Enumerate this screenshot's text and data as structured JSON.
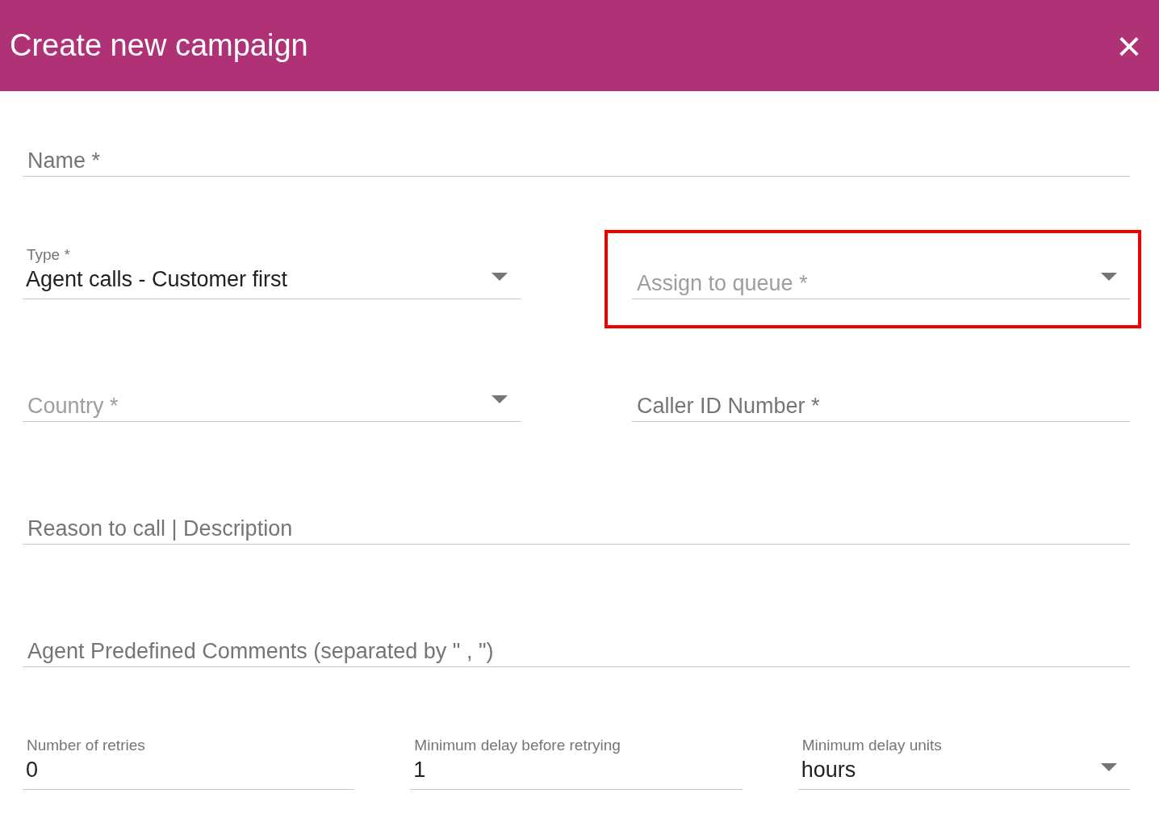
{
  "dialog": {
    "title": "Create new campaign",
    "close_symbol": "×"
  },
  "rows": [
    [
      {
        "kind": "text",
        "label": "Name *"
      }
    ],
    [
      {
        "kind": "select",
        "label": "Type *",
        "value": "Agent calls - Customer first"
      },
      {
        "kind": "select",
        "label": "Assign to queue *",
        "highlighted": true
      }
    ],
    [
      {
        "kind": "select",
        "label": "Country *"
      },
      {
        "kind": "text",
        "label": "Caller ID Number *"
      }
    ],
    [
      {
        "kind": "text",
        "label": "Reason to call | Description"
      }
    ],
    [
      {
        "kind": "text",
        "label": "Agent Predefined Comments (separated by \" , \")"
      }
    ],
    [
      {
        "kind": "text",
        "label": "Number of retries",
        "value": "0"
      },
      {
        "kind": "text",
        "label": "Minimum delay before retrying",
        "value": "1"
      },
      {
        "kind": "select",
        "label": "Minimum delay units",
        "value": "hours"
      }
    ]
  ]
}
